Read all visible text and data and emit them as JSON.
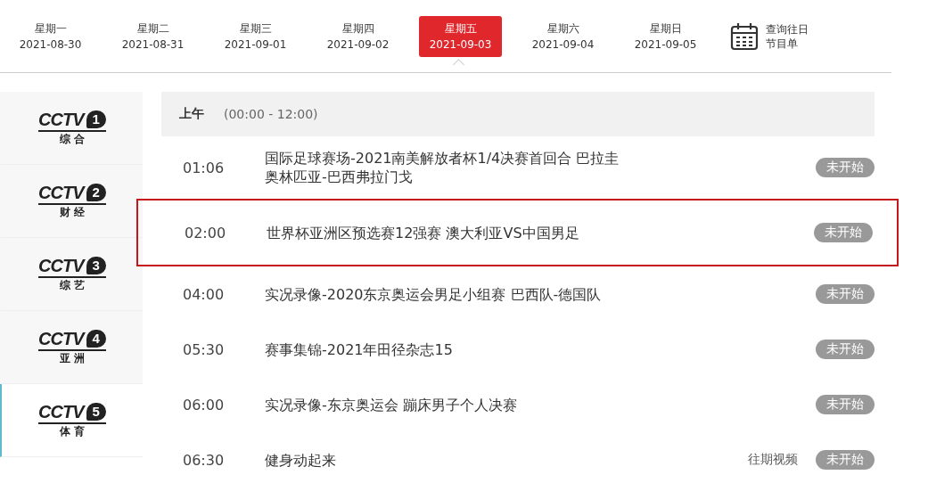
{
  "days": [
    {
      "weekday": "星期一",
      "date": "2021-08-30",
      "selected": false
    },
    {
      "weekday": "星期二",
      "date": "2021-08-31",
      "selected": false
    },
    {
      "weekday": "星期三",
      "date": "2021-09-01",
      "selected": false
    },
    {
      "weekday": "星期四",
      "date": "2021-09-02",
      "selected": false
    },
    {
      "weekday": "星期五",
      "date": "2021-09-03",
      "selected": true
    },
    {
      "weekday": "星期六",
      "date": "2021-09-04",
      "selected": false
    },
    {
      "weekday": "星期日",
      "date": "2021-09-05",
      "selected": false
    }
  ],
  "history_link": {
    "line1": "查询往日",
    "line2": "节目单"
  },
  "channels": [
    {
      "logo": "CCTV",
      "number": "1",
      "name": "综 合",
      "selected": false
    },
    {
      "logo": "CCTV",
      "number": "2",
      "name": "财 经",
      "selected": false
    },
    {
      "logo": "CCTV",
      "number": "3",
      "name": "综 艺",
      "selected": false
    },
    {
      "logo": "CCTV",
      "number": "4",
      "name": "亚 洲",
      "selected": false
    },
    {
      "logo": "CCTV",
      "number": "5",
      "name": "体 育",
      "selected": true
    }
  ],
  "section": {
    "label": "上午",
    "range": "(00:00 - 12:00)"
  },
  "programs": [
    {
      "time": "01:06",
      "title": "国际足球赛场-2021南美解放者杯1/4决赛首回合 巴拉圭奥林匹亚-巴西弗拉门戈",
      "status": "未开始",
      "highlighted": false
    },
    {
      "time": "02:00",
      "title": "世界杯亚洲区预选赛12强赛 澳大利亚VS中国男足",
      "status": "未开始",
      "highlighted": true
    },
    {
      "time": "04:00",
      "title": "实况录像-2020东京奥运会男足小组赛 巴西队-德国队",
      "status": "未开始",
      "highlighted": false
    },
    {
      "time": "05:30",
      "title": "赛事集锦-2021年田径杂志15",
      "status": "未开始",
      "highlighted": false
    },
    {
      "time": "06:00",
      "title": "实况录像-东京奥运会 蹦床男子个人决赛",
      "status": "未开始",
      "highlighted": false
    },
    {
      "time": "06:30",
      "title": "健身动起来",
      "replay": "往期视频",
      "status": "未开始",
      "highlighted": false
    }
  ]
}
